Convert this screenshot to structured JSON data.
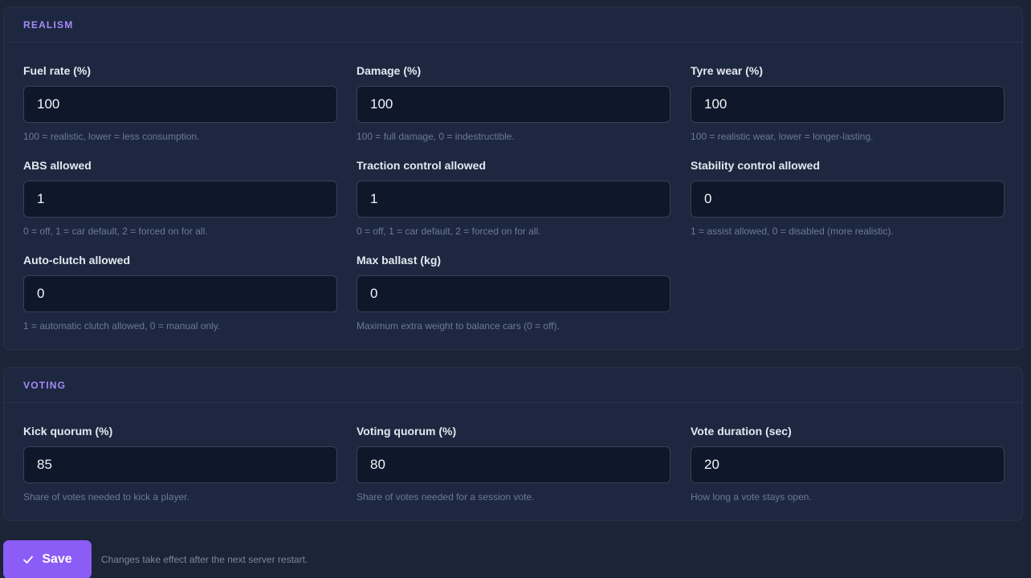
{
  "realism": {
    "title": "REALISM",
    "fields": [
      {
        "label": "Fuel rate (%)",
        "value": "100",
        "hint": "100 = realistic, lower = less consumption."
      },
      {
        "label": "Damage (%)",
        "value": "100",
        "hint": "100 = full damage, 0 = indestructible."
      },
      {
        "label": "Tyre wear (%)",
        "value": "100",
        "hint": "100 = realistic wear, lower = longer-lasting."
      },
      {
        "label": "ABS allowed",
        "value": "1",
        "hint": "0 = off, 1 = car default, 2 = forced on for all."
      },
      {
        "label": "Traction control allowed",
        "value": "1",
        "hint": "0 = off, 1 = car default, 2 = forced on for all."
      },
      {
        "label": "Stability control allowed",
        "value": "0",
        "hint": "1 = assist allowed, 0 = disabled (more realistic)."
      },
      {
        "label": "Auto-clutch allowed",
        "value": "0",
        "hint": "1 = automatic clutch allowed, 0 = manual only."
      },
      {
        "label": "Max ballast (kg)",
        "value": "0",
        "hint": "Maximum extra weight to balance cars (0 = off)."
      }
    ]
  },
  "voting": {
    "title": "VOTING",
    "fields": [
      {
        "label": "Kick quorum (%)",
        "value": "85",
        "hint": "Share of votes needed to kick a player."
      },
      {
        "label": "Voting quorum (%)",
        "value": "80",
        "hint": "Share of votes needed for a session vote."
      },
      {
        "label": "Vote duration (sec)",
        "value": "20",
        "hint": "How long a vote stays open."
      }
    ]
  },
  "footer": {
    "save_label": "Save",
    "save_icon": "check-icon",
    "note": "Changes take effect after the next server restart."
  },
  "colors": {
    "background": "#1b2537",
    "panel": "#1d2840",
    "input": "#0f172a",
    "accent": "#8b5cf6",
    "section_title": "#a78bfa"
  }
}
